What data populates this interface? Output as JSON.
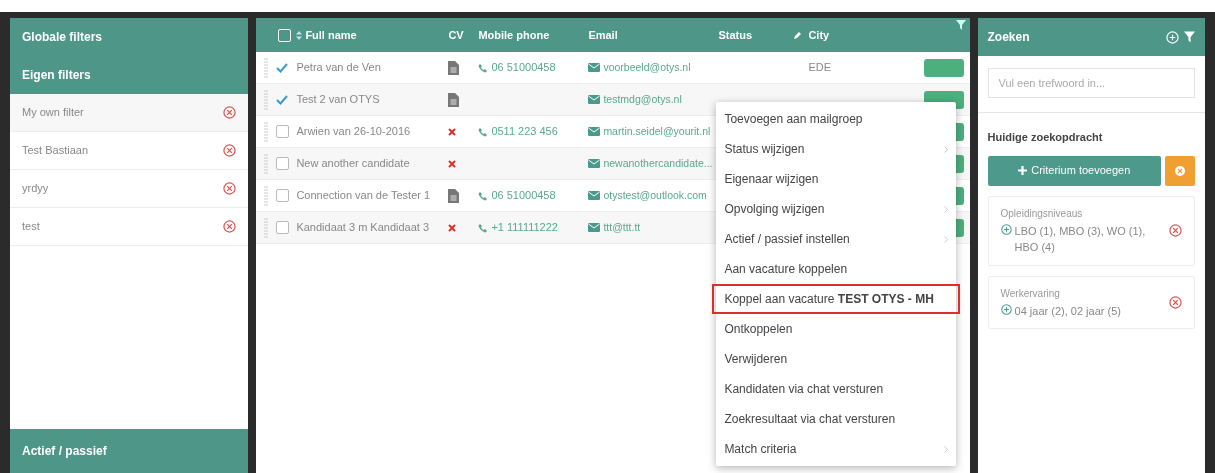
{
  "left_panel": {
    "headers": [
      "Globale filters",
      "Eigen filters"
    ],
    "filters": [
      {
        "label": "My own filter"
      },
      {
        "label": "Test Bastiaan"
      },
      {
        "label": "yrdyy"
      },
      {
        "label": "test"
      }
    ],
    "footer": "Actief / passief"
  },
  "table": {
    "columns": [
      "Full name",
      "CV",
      "Mobile phone",
      "Email",
      "Status",
      "City"
    ],
    "header_checked": false,
    "rows": [
      {
        "checked": true,
        "name": "Petra van de Ven",
        "kind": "document",
        "phone": "06 51000458",
        "email": "voorbeeld@otys.nl",
        "city": "EDE"
      },
      {
        "checked": true,
        "name": "Test 2 van OTYS",
        "kind": "document",
        "phone": "",
        "email": "testmdg@otys.nl",
        "city": ""
      },
      {
        "checked": false,
        "name": "Arwien van 26-10-2016",
        "kind": "missing",
        "phone": "0511 223 456",
        "email": "martin.seidel@yourit.nl",
        "city": ""
      },
      {
        "checked": false,
        "name": "New another candidate",
        "kind": "missing",
        "phone": "",
        "email": "newanothercandidate...",
        "city": ""
      },
      {
        "checked": false,
        "name": "Connection van de Tester 1",
        "kind": "document",
        "phone": "06 51000458",
        "email": "otystest@outlook.com",
        "city": ""
      },
      {
        "checked": false,
        "name": "Kandidaat 3 m Kandidaat 3",
        "kind": "missing",
        "phone": "+1 111111222",
        "email": "ttt@ttt.tt",
        "city": ""
      }
    ]
  },
  "context_menu": [
    {
      "label": "Toevoegen aan mailgroep",
      "submenu": false,
      "highlighted": false
    },
    {
      "label": "Status wijzigen",
      "submenu": true,
      "highlighted": false
    },
    {
      "label": "Eigenaar wijzigen",
      "submenu": false,
      "highlighted": false
    },
    {
      "label": "Opvolging wijzigen",
      "submenu": true,
      "highlighted": false
    },
    {
      "label": "Actief / passief instellen",
      "submenu": true,
      "highlighted": false
    },
    {
      "label": "Aan vacature koppelen",
      "submenu": false,
      "highlighted": false
    },
    {
      "label": "Koppel aan vacature **TEST OTYS - MH**",
      "submenu": false,
      "highlighted": true
    },
    {
      "label": "Ontkoppelen",
      "submenu": false,
      "highlighted": false
    },
    {
      "label": "Verwijderen",
      "submenu": false,
      "highlighted": false
    },
    {
      "label": "Kandidaten via chat versturen",
      "submenu": false,
      "highlighted": false
    },
    {
      "label": "Zoekresultaat via chat versturen",
      "submenu": false,
      "highlighted": false
    },
    {
      "label": "Match criteria",
      "submenu": true,
      "highlighted": false
    }
  ],
  "search_panel": {
    "title": "Zoeken",
    "search": {
      "placeholder": "Vul een trefwoord in..."
    },
    "section_title": "Huidige zoekopdracht",
    "add_button": "Criterium toevoegen",
    "criteria": [
      {
        "label": "Opleidingsniveaus",
        "value": "LBO (1), MBO (3), WO (1), HBO (4)"
      },
      {
        "label": "Werkervaring",
        "value": "04 jaar (2), 02 jaar (5)"
      }
    ]
  }
}
